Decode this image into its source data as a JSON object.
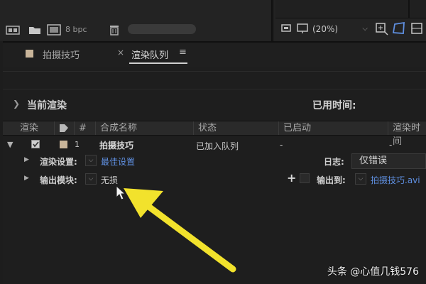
{
  "toolbar": {
    "bit_depth": "8 bpc",
    "zoom": "(20%)",
    "icons": [
      "node-icon",
      "folder-icon",
      "comp-icon",
      "trash-icon",
      "camera-icon",
      "monitor-icon",
      "chevron-down-icon",
      "crosshair-icon",
      "mask-icon",
      "grid-icon"
    ]
  },
  "tabs": [
    {
      "label": "拍摄技巧",
      "close": "×"
    },
    {
      "label": "渲染队列",
      "menu": "≡"
    }
  ],
  "section": {
    "title": "当前渲染",
    "elapsed": "已用时间:"
  },
  "columns": {
    "render": "渲染",
    "num": "#",
    "comp_name": "合成名称",
    "status": "状态",
    "started": "已启动",
    "render_time": "渲染时间"
  },
  "queue_item": {
    "number": "1",
    "comp_name": "拍摄技巧",
    "status": "已加入队列",
    "started": "-",
    "render_time": "-",
    "render_settings_label": "渲染设置:",
    "render_settings_value": "最佳设置",
    "log_label": "日志:",
    "log_value": "仅错误",
    "output_module_label": "输出模块:",
    "output_module_value": "无损",
    "output_to_label": "输出到:",
    "output_to_value": "拍摄技巧.avi"
  },
  "watermark": "头条 @心值几钱576",
  "colors": {
    "background": "#1d1d1d",
    "link": "#5f8fe0",
    "arrow": "#f2e22c",
    "label_swatch": "#c9b59a"
  }
}
